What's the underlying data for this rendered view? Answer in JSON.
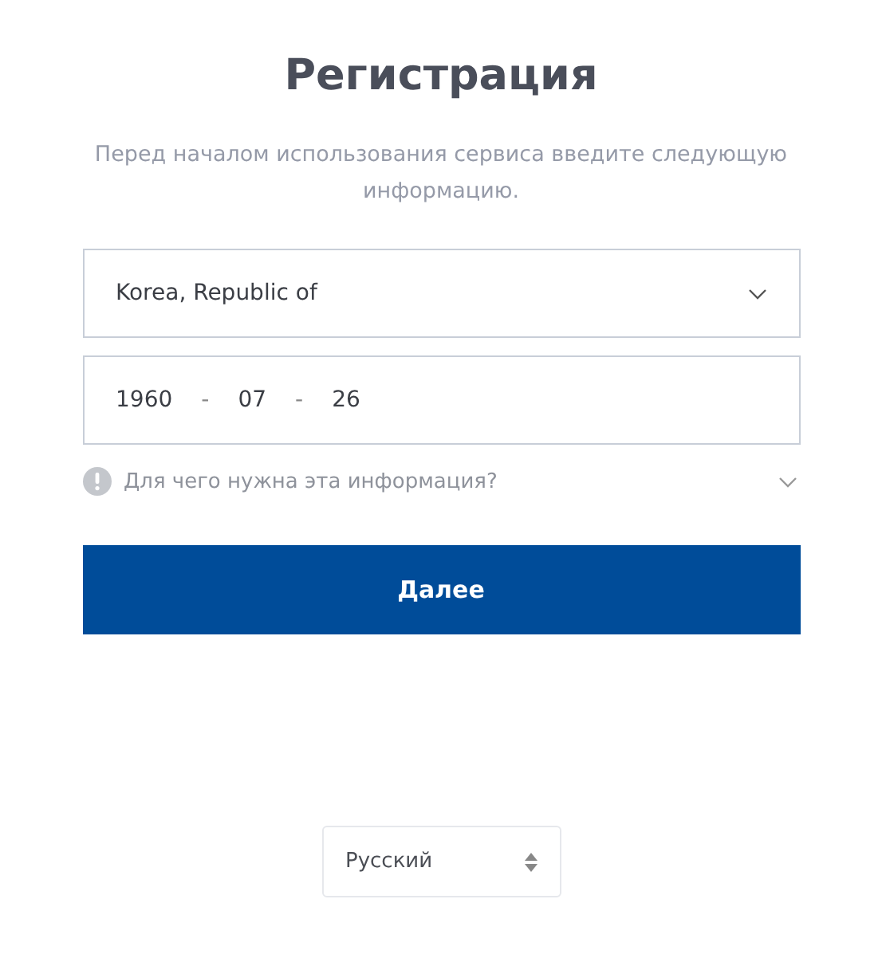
{
  "title": "Регистрация",
  "subtitle": "Перед началом использования сервиса введите следующую информацию.",
  "country_select": {
    "value": "Korea, Republic of"
  },
  "birth_date": {
    "year": "1960",
    "separator_1": "-",
    "month": "07",
    "separator_2": "-",
    "day": "26"
  },
  "info_toggle": {
    "label": "Для чего нужна эта информация?"
  },
  "next_button": {
    "label": "Далее"
  },
  "language_select": {
    "value": "Русский"
  }
}
